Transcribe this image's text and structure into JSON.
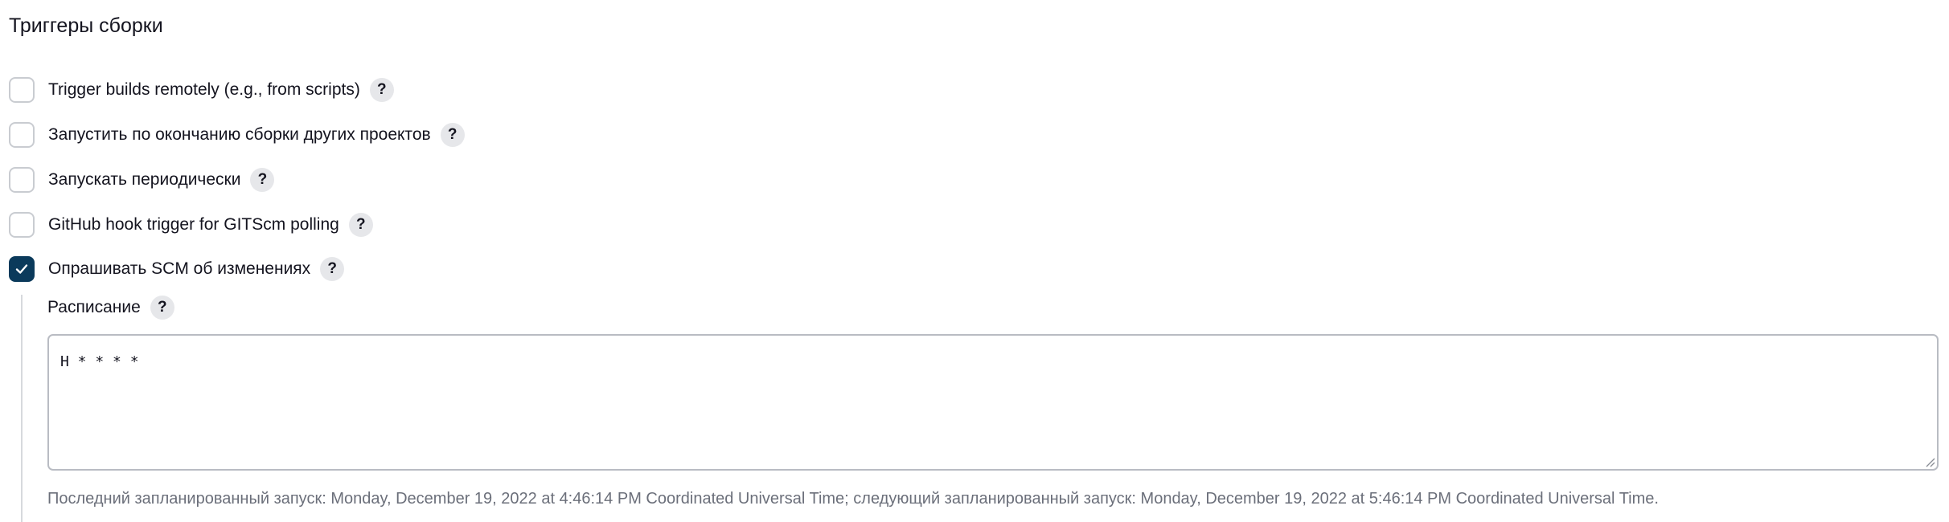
{
  "build_triggers": {
    "title": "Триггеры сборки",
    "options": [
      {
        "label": "Trigger builds remotely (e.g., from scripts)",
        "checked": false,
        "help": "?"
      },
      {
        "label": "Запустить по окончанию сборки других проектов",
        "checked": false,
        "help": "?"
      },
      {
        "label": "Запускать периодически",
        "checked": false,
        "help": "?"
      },
      {
        "label": "GitHub hook trigger for GITScm polling",
        "checked": false,
        "help": "?"
      },
      {
        "label": "Опрашивать SCM об изменениях",
        "checked": true,
        "help": "?"
      }
    ],
    "schedule": {
      "label": "Расписание",
      "help": "?",
      "value": "H * * * *",
      "hint": "Последний запланированный запуск: Monday, December 19, 2022 at 4:46:14 PM Coordinated Universal Time; следующий запланированный запуск: Monday, December 19, 2022 at 5:46:14 PM Coordinated Universal Time."
    }
  },
  "colors": {
    "checkbox_checked": "#0b3a5b",
    "checkbox_border": "#c9ccd1",
    "help_bg": "#e6e7ea",
    "hint_text": "#6b6f7a"
  },
  "icons": {
    "checkmark": "check-icon",
    "help": "help-icon",
    "resize": "resize-grip-icon"
  }
}
